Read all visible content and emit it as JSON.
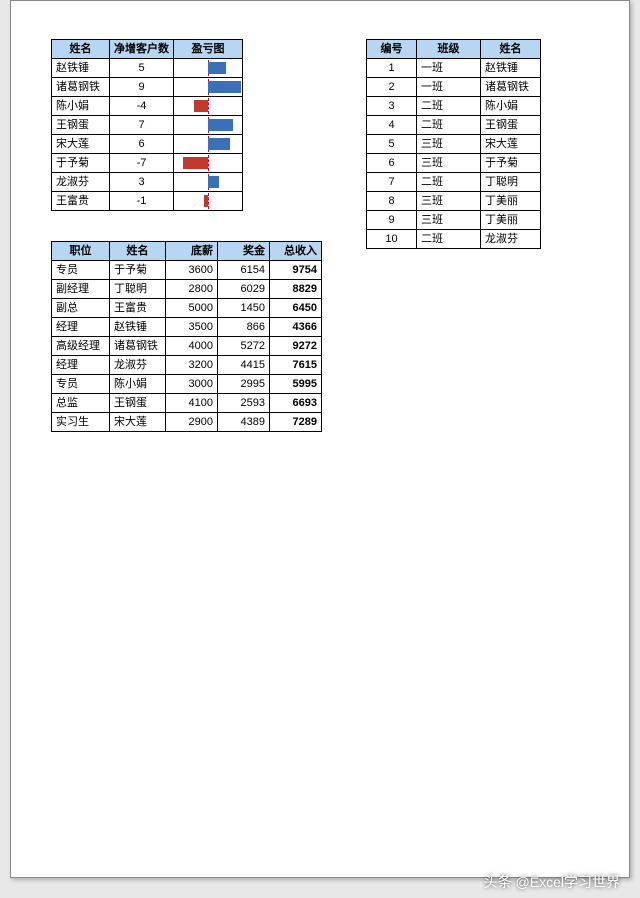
{
  "table1": {
    "headers": [
      "姓名",
      "净增客户数",
      "盈亏图"
    ],
    "rows": [
      {
        "name": "赵铁锤",
        "delta": 5
      },
      {
        "name": "诸葛钢铁",
        "delta": 9
      },
      {
        "name": "陈小娟",
        "delta": -4
      },
      {
        "name": "王钢蛋",
        "delta": 7
      },
      {
        "name": "宋大莲",
        "delta": 6
      },
      {
        "name": "于予菊",
        "delta": -7
      },
      {
        "name": "龙淑芬",
        "delta": 3
      },
      {
        "name": "王富贵",
        "delta": -1
      }
    ]
  },
  "table2": {
    "headers": [
      "编号",
      "班级",
      "姓名"
    ],
    "rows": [
      {
        "id": 1,
        "cls": "一班",
        "name": "赵铁锤"
      },
      {
        "id": 2,
        "cls": "一班",
        "name": "诸葛钢铁"
      },
      {
        "id": 3,
        "cls": "二班",
        "name": "陈小娟"
      },
      {
        "id": 4,
        "cls": "二班",
        "name": "王钢蛋"
      },
      {
        "id": 5,
        "cls": "三班",
        "name": "宋大莲"
      },
      {
        "id": 6,
        "cls": "三班",
        "name": "于予菊"
      },
      {
        "id": 7,
        "cls": "二班",
        "name": "丁聪明"
      },
      {
        "id": 8,
        "cls": "三班",
        "name": "丁美丽"
      },
      {
        "id": 9,
        "cls": "三班",
        "name": "丁美丽"
      },
      {
        "id": 10,
        "cls": "二班",
        "name": "龙淑芬"
      }
    ]
  },
  "table3": {
    "headers": [
      "职位",
      "姓名",
      "底薪",
      "奖金",
      "总收入"
    ],
    "rows": [
      {
        "role": "专员",
        "name": "于予菊",
        "base": 3600,
        "bonus": 6154,
        "total": 9754
      },
      {
        "role": "副经理",
        "name": "丁聪明",
        "base": 2800,
        "bonus": 6029,
        "total": 8829
      },
      {
        "role": "副总",
        "name": "王富贵",
        "base": 5000,
        "bonus": 1450,
        "total": 6450
      },
      {
        "role": "经理",
        "name": "赵铁锤",
        "base": 3500,
        "bonus": 866,
        "total": 4366
      },
      {
        "role": "高级经理",
        "name": "诸葛钢铁",
        "base": 4000,
        "bonus": 5272,
        "total": 9272
      },
      {
        "role": "经理",
        "name": "龙淑芬",
        "base": 3200,
        "bonus": 4415,
        "total": 7615
      },
      {
        "role": "专员",
        "name": "陈小娟",
        "base": 3000,
        "bonus": 2995,
        "total": 5995
      },
      {
        "role": "总监",
        "name": "王钢蛋",
        "base": 4100,
        "bonus": 2593,
        "total": 6693
      },
      {
        "role": "实习生",
        "name": "宋大莲",
        "base": 2900,
        "bonus": 4389,
        "total": 7289
      }
    ]
  },
  "watermark": "头条 @Excel学习世界",
  "chart_data": {
    "type": "bar",
    "orientation": "horizontal",
    "categories": [
      "赵铁锤",
      "诸葛钢铁",
      "陈小娟",
      "王钢蛋",
      "宋大莲",
      "于予菊",
      "龙淑芬",
      "王富贵"
    ],
    "values": [
      5,
      9,
      -4,
      7,
      6,
      -7,
      3,
      -1
    ],
    "title": "盈亏图",
    "ylabel": "净增客户数",
    "xlim": [
      -9,
      9
    ]
  }
}
